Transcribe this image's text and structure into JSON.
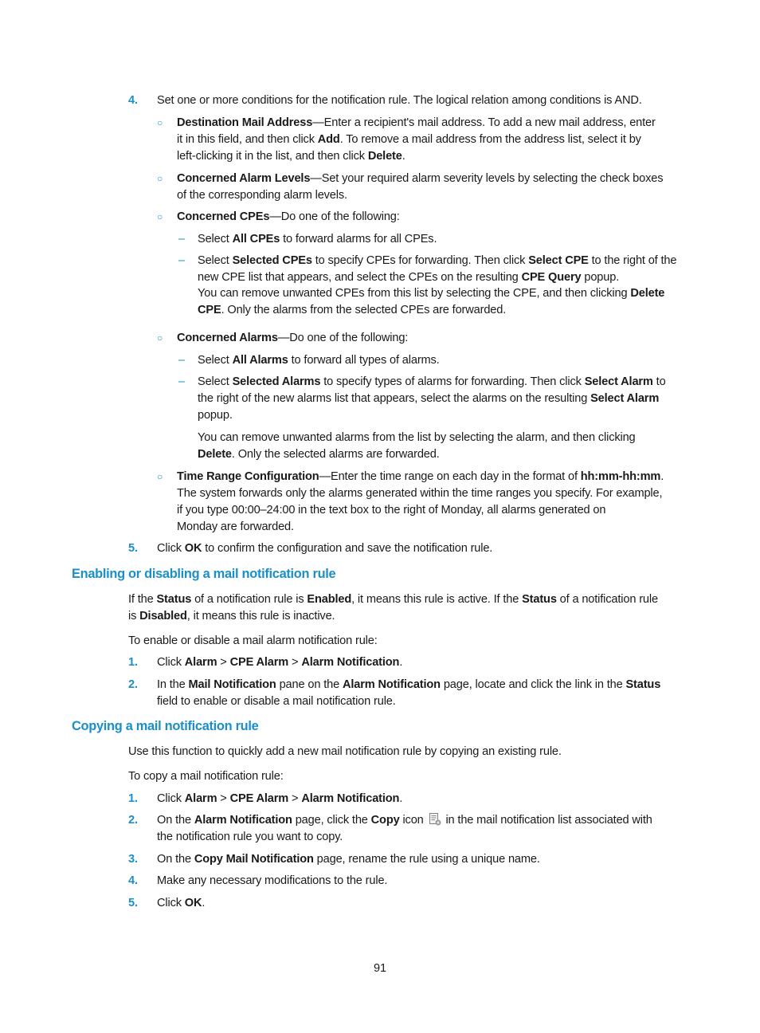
{
  "step4": {
    "number": "4.",
    "text": "Set one or more conditions for the notification rule. The logical relation among conditions is AND.",
    "conditions": [
      {
        "term": "Destination Mail Address",
        "lines": [
          [
            "—Enter a recipient's mail address. To add a new mail address, enter"
          ],
          [
            "it in this field, and then click ",
            {
              "b": "Add"
            },
            ". To remove a mail address from the address list, select it by"
          ],
          [
            "left-clicking it in the list, and then click ",
            {
              "b": "Delete"
            },
            "."
          ]
        ]
      },
      {
        "term": "Concerned Alarm Levels",
        "lines": [
          [
            "—Set your required alarm severity levels by selecting the check boxes"
          ],
          [
            "of the corresponding alarm levels."
          ]
        ]
      },
      {
        "term": "Concerned CPEs",
        "lines": [
          [
            "—Do one of the following:"
          ]
        ],
        "options": [
          {
            "lines": [
              [
                "Select ",
                {
                  "b": "All CPEs"
                },
                " to forward alarms for all CPEs."
              ]
            ]
          },
          {
            "lines": [
              [
                "Select ",
                {
                  "b": "Selected CPEs"
                },
                " to specify CPEs for forwarding. Then click ",
                {
                  "b": "Select CPE"
                },
                " to the right of the"
              ],
              [
                "new CPE list that appears, and select the CPEs on the resulting ",
                {
                  "b": "CPE Query"
                },
                " popup."
              ]
            ],
            "note": [
              [
                "You can remove unwanted CPEs from this list by selecting the CPE, and then clicking ",
                {
                  "b": "Delete"
                }
              ],
              [
                {
                  "b": "CPE"
                },
                ". Only the alarms from the selected CPEs are forwarded."
              ]
            ]
          }
        ]
      },
      {
        "term": "Concerned Alarms",
        "lines": [
          [
            "—Do one of the following:"
          ]
        ],
        "options": [
          {
            "lines": [
              [
                "Select ",
                {
                  "b": "All Alarms"
                },
                " to forward all types of alarms."
              ]
            ]
          },
          {
            "lines": [
              [
                "Select ",
                {
                  "b": "Selected Alarms"
                },
                " to specify types of alarms for forwarding. Then click ",
                {
                  "b": "Select Alarm"
                },
                " to"
              ],
              [
                "the right of the new alarms list that appears, select the alarms on the resulting ",
                {
                  "b": "Select Alarm"
                }
              ],
              [
                "popup."
              ]
            ],
            "note": [
              [
                "You can remove unwanted alarms from the list by selecting the alarm, and then clicking"
              ],
              [
                {
                  "b": "Delete"
                },
                ". Only the selected alarms are forwarded."
              ]
            ]
          }
        ]
      },
      {
        "term": "Time Range Configuration",
        "lines": [
          [
            "—Enter the time range on each day in the format of ",
            {
              "b": "hh:mm-hh:mm"
            },
            "."
          ],
          [
            "The system forwards only the alarms generated within the time ranges you specify. For example,"
          ],
          [
            "if you type 00:00–24:00 in the text box to the right of Monday, all alarms generated on"
          ],
          [
            "Monday are forwarded."
          ]
        ]
      }
    ]
  },
  "step5": {
    "number": "5.",
    "line": [
      "Click ",
      {
        "b": "OK"
      },
      " to confirm the configuration and save the notification rule."
    ]
  },
  "section_enable": {
    "heading": "Enabling or disabling a mail notification rule",
    "para1": [
      [
        "If the ",
        {
          "b": "Status"
        },
        " of a notification rule is ",
        {
          "b": "Enabled"
        },
        ", it means this rule is active. If the ",
        {
          "b": "Status"
        },
        " of a notification rule"
      ],
      [
        "is ",
        {
          "b": "Disabled"
        },
        ", it means this rule is inactive."
      ]
    ],
    "intro": "To enable or disable a mail alarm notification rule:",
    "steps": [
      {
        "number": "1.",
        "lines": [
          [
            "Click ",
            {
              "b": "Alarm"
            },
            " > ",
            {
              "b": "CPE Alarm"
            },
            " > ",
            {
              "b": "Alarm Notification"
            },
            "."
          ]
        ]
      },
      {
        "number": "2.",
        "lines": [
          [
            "In the ",
            {
              "b": "Mail Notification"
            },
            " pane on the ",
            {
              "b": "Alarm Notification"
            },
            " page, locate and click the link in the ",
            {
              "b": "Status"
            }
          ],
          [
            "field to enable or disable a mail notification rule."
          ]
        ]
      }
    ]
  },
  "section_copy": {
    "heading": "Copying a mail notification rule",
    "para1": "Use this function to quickly add a new mail notification rule by copying an existing rule.",
    "intro": "To copy a mail notification rule:",
    "steps": [
      {
        "number": "1.",
        "lines": [
          [
            "Click ",
            {
              "b": "Alarm"
            },
            " > ",
            {
              "b": "CPE Alarm"
            },
            " > ",
            {
              "b": "Alarm Notification"
            },
            "."
          ]
        ]
      },
      {
        "number": "2.",
        "lines": [
          [
            "On the ",
            {
              "b": "Alarm Notification"
            },
            " page, click the ",
            {
              "b": "Copy"
            },
            " icon ",
            {
              "icon": "copy-icon"
            },
            " in the mail notification list associated with"
          ],
          [
            "the notification rule you want to copy."
          ]
        ]
      },
      {
        "number": "3.",
        "lines": [
          [
            "On the ",
            {
              "b": "Copy Mail Notification"
            },
            " page, rename the rule using a unique name."
          ]
        ]
      },
      {
        "number": "4.",
        "lines": [
          [
            "Make any necessary modifications to the rule."
          ]
        ]
      },
      {
        "number": "5.",
        "lines": [
          [
            "Click ",
            {
              "b": "OK"
            },
            "."
          ]
        ]
      }
    ]
  },
  "icons": {
    "bullet_circle": "○",
    "bullet_dash": "–",
    "copy_icon_name": "copy-icon"
  },
  "page_number": "91"
}
